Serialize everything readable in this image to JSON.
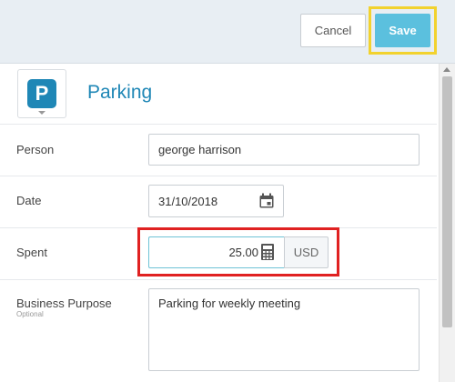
{
  "header": {
    "cancel_label": "Cancel",
    "save_label": "Save"
  },
  "expense": {
    "category_icon_letter": "P",
    "category_title": "Parking"
  },
  "form": {
    "person": {
      "label": "Person",
      "value": "george harrison"
    },
    "date": {
      "label": "Date",
      "value": "31/10/2018"
    },
    "spent": {
      "label": "Spent",
      "value": "25.00",
      "currency": "USD"
    },
    "business_purpose": {
      "label": "Business Purpose",
      "sublabel": "Optional",
      "value": "Parking for weekly meeting"
    }
  },
  "colors": {
    "accent": "#1f87b6",
    "save_button": "#5bc0de",
    "save_highlight": "#f2d22e",
    "spent_highlight": "#e02121"
  },
  "icons": {
    "category": "parking-icon",
    "date": "calendar-icon",
    "amount": "calculator-icon"
  }
}
